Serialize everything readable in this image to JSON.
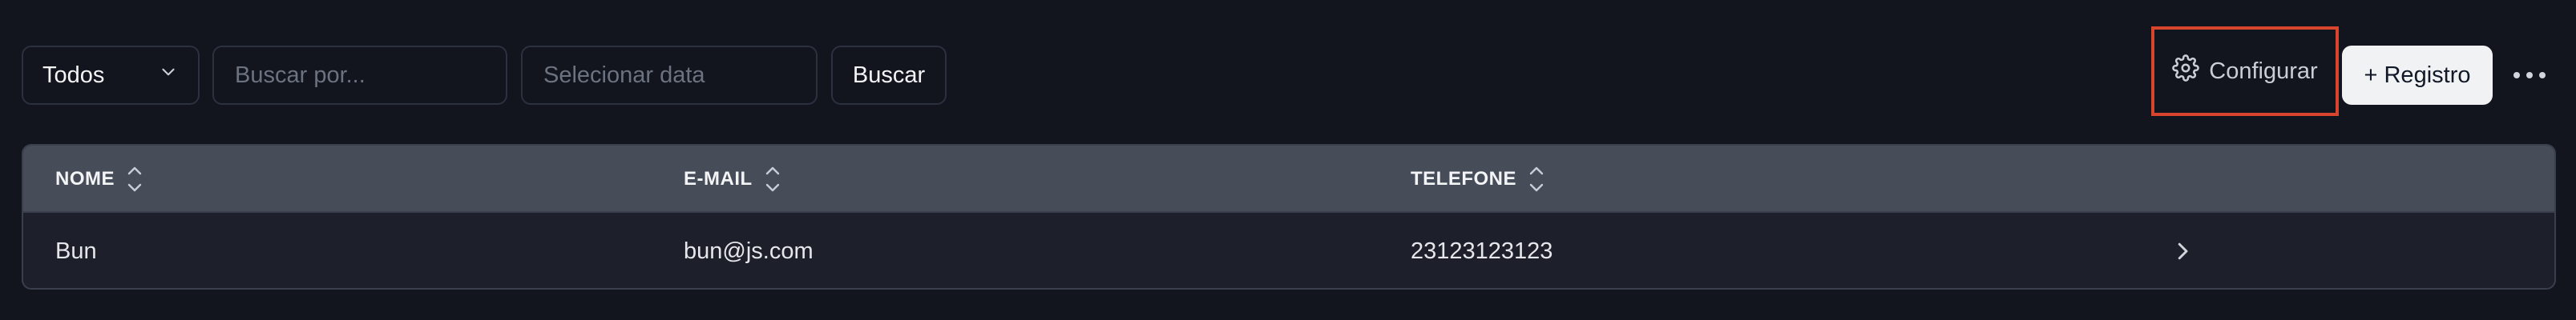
{
  "filters": {
    "select_value": "Todos",
    "search_placeholder": "Buscar por...",
    "date_placeholder": "Selecionar data",
    "search_button": "Buscar"
  },
  "actions": {
    "configure_label": "Configurar",
    "add_label": "+ Registro"
  },
  "colors": {
    "highlight": "#d9452c",
    "header_bg": "#474c59",
    "page_bg": "#12141e"
  },
  "table": {
    "columns": [
      "NOME",
      "E-MAIL",
      "TELEFONE"
    ],
    "rows": [
      {
        "nome": "Bun",
        "email": "bun@js.com",
        "telefone": "23123123123"
      }
    ]
  },
  "icons": {
    "select": "chevron-down-icon",
    "configure": "gear-icon",
    "more": "more-horizontal-icon",
    "sort": "sort-icon",
    "row": "chevron-right-icon"
  }
}
